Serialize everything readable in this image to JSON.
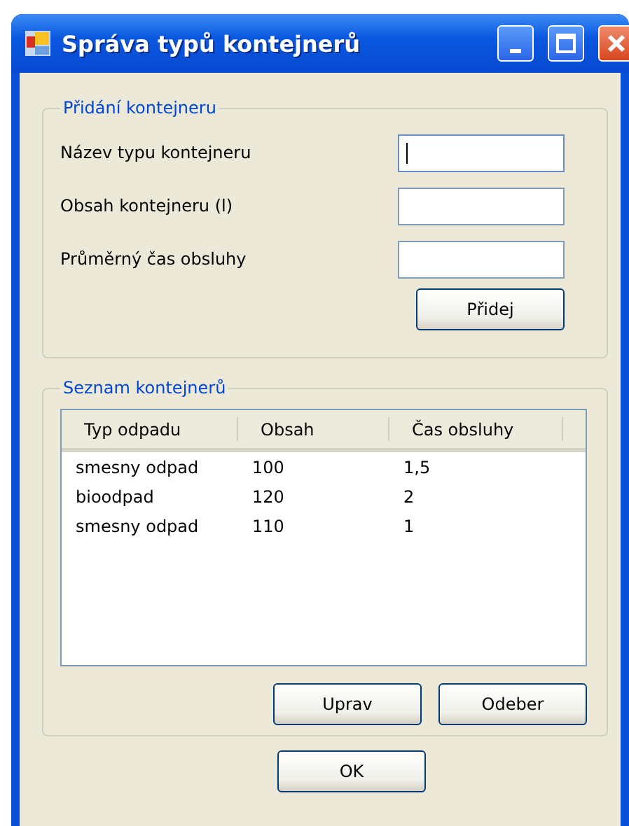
{
  "window": {
    "title": "Správa typů kontejnerů"
  },
  "add_group": {
    "legend": "Přidání kontejneru",
    "fields": [
      {
        "label": "Název typu kontejneru",
        "focused": true
      },
      {
        "label": "Obsah kontejneru (l)",
        "focused": false
      },
      {
        "label": "Průměrný čas obsluhy",
        "focused": false
      }
    ],
    "button": "Přidej"
  },
  "list_group": {
    "legend": "Seznam kontejnerů",
    "columns": [
      "Typ odpadu",
      "Obsah",
      "Čas obsluhy"
    ],
    "rows": [
      [
        "smesny odpad",
        "100",
        "1,5"
      ],
      [
        "bioodpad",
        "120",
        "2"
      ],
      [
        "smesny odpad",
        "110",
        "1"
      ]
    ],
    "buttons": [
      "Uprav",
      "Odeber"
    ]
  },
  "ok_button": "OK"
}
